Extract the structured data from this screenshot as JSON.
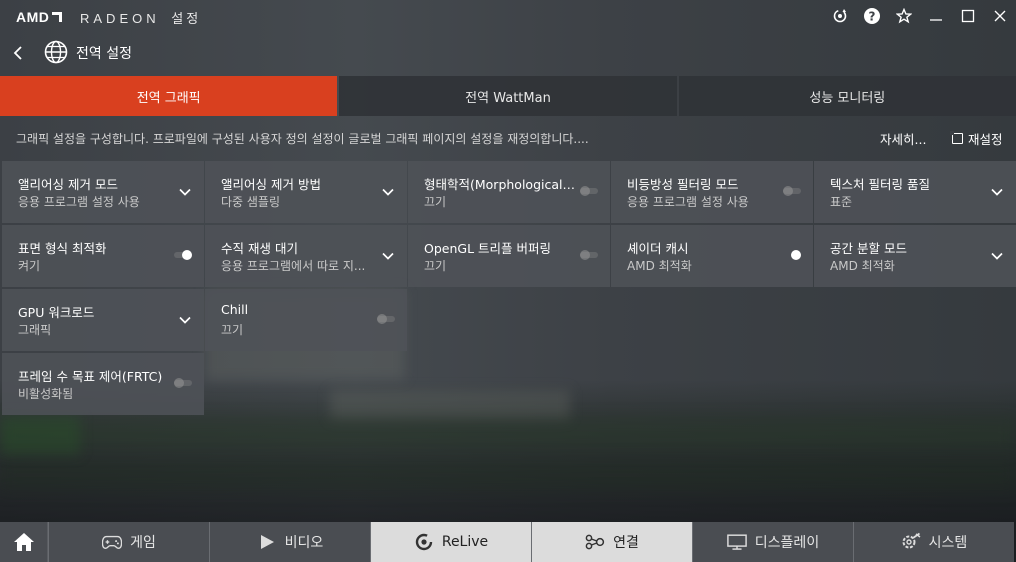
{
  "app": {
    "brand": "AMD",
    "product": "RADEON",
    "title_suffix": "설정",
    "window_icons": [
      "update-icon",
      "help-icon",
      "favorite-icon",
      "minimize-icon",
      "maximize-icon",
      "close-icon"
    ]
  },
  "header": {
    "title": "전역 설정"
  },
  "tabs": [
    {
      "label": "전역 그래픽",
      "active": true
    },
    {
      "label": "전역 WattMan",
      "active": false
    },
    {
      "label": "성능 모니터링",
      "active": false
    }
  ],
  "description": {
    "text": "그래픽 설정을 구성합니다. 프로파일에 구성된 사용자 정의 설정이 글로벌 그래픽 페이지의 설정을 재정의합니다....",
    "more_label": "자세히...",
    "reset_label": "재설정"
  },
  "settings": [
    {
      "label": "앨리어싱 제거 모드",
      "value": "응용 프로그램 설정 사용",
      "control": "dropdown"
    },
    {
      "label": "앨리어싱 제거 방법",
      "value": "다중 샘플링",
      "control": "dropdown"
    },
    {
      "label": "형태학적(Morphological) ...",
      "value": "끄기",
      "control": "toggle",
      "on": false
    },
    {
      "label": "비등방성 필터링 모드",
      "value": "응용 프로그램 설정 사용",
      "control": "toggle",
      "on": false
    },
    {
      "label": "텍스처 필터링 품질",
      "value": "표준",
      "control": "dropdown"
    },
    {
      "label": "표면 형식 최적화",
      "value": "켜기",
      "control": "toggle",
      "on": true
    },
    {
      "label": "수직 재생 대기",
      "value": "응용 프로그램에서 따로 지...",
      "control": "dropdown"
    },
    {
      "label": "OpenGL 트리플 버퍼링",
      "value": "끄기",
      "control": "toggle",
      "on": false
    },
    {
      "label": "셰이더 캐시",
      "value": "AMD 최적화",
      "control": "toggle",
      "on": true
    },
    {
      "label": "공간 분할 모드",
      "value": "AMD 최적화",
      "control": "dropdown"
    },
    {
      "label": "GPU 워크로드",
      "value": "그래픽",
      "control": "dropdown"
    },
    {
      "label": "Chill",
      "value": "끄기",
      "control": "toggle",
      "on": false
    },
    {
      "label": "프레임 수 목표 제어(FRTC)",
      "value": "비활성화됨",
      "control": "toggle",
      "on": false
    }
  ],
  "bottom_nav": [
    {
      "label": "게임",
      "icon": "gamepad-icon"
    },
    {
      "label": "비디오",
      "icon": "play-icon"
    },
    {
      "label": "ReLive",
      "icon": "relive-icon"
    },
    {
      "label": "연결",
      "icon": "connect-icon"
    },
    {
      "label": "디스플레이",
      "icon": "monitor-icon"
    },
    {
      "label": "시스템",
      "icon": "system-gear-icon"
    }
  ],
  "colors": {
    "accent": "#d9401f",
    "tile_bg": "#4e5258",
    "nav_light": "#dcdcdc"
  }
}
